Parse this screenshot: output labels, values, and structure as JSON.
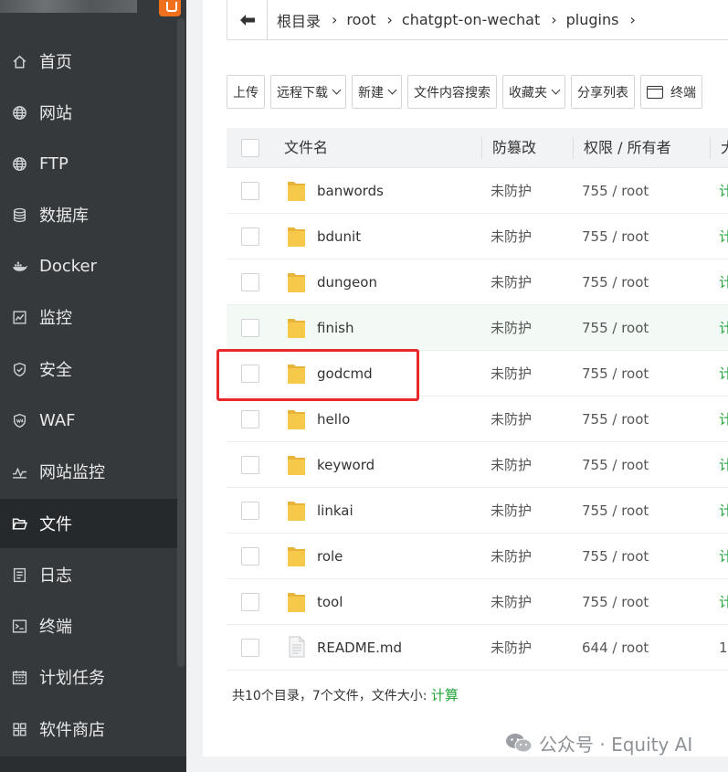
{
  "sidebar": {
    "items": [
      {
        "label": "首页",
        "icon": "home-icon"
      },
      {
        "label": "网站",
        "icon": "globe-icon"
      },
      {
        "label": "FTP",
        "icon": "ftp-globe-icon"
      },
      {
        "label": "数据库",
        "icon": "database-icon"
      },
      {
        "label": "Docker",
        "icon": "docker-whale-icon"
      },
      {
        "label": "监控",
        "icon": "monitor-chart-icon"
      },
      {
        "label": "安全",
        "icon": "shield-icon"
      },
      {
        "label": "WAF",
        "icon": "waf-shield-icon"
      },
      {
        "label": "网站监控",
        "icon": "pulse-line-icon"
      },
      {
        "label": "文件",
        "icon": "folder-open-icon"
      },
      {
        "label": "日志",
        "icon": "log-document-icon"
      },
      {
        "label": "终端",
        "icon": "terminal-icon"
      },
      {
        "label": "计划任务",
        "icon": "calendar-icon"
      },
      {
        "label": "软件商店",
        "icon": "grid-apps-icon"
      }
    ],
    "active_item": "文件"
  },
  "breadcrumb": {
    "items": [
      "根目录",
      "root",
      "chatgpt-on-wechat",
      "plugins"
    ]
  },
  "toolbar": {
    "upload": "上传",
    "remote_download": "远程下载",
    "new": "新建",
    "content_search": "文件内容搜索",
    "favorites": "收藏夹",
    "share_list": "分享列表",
    "terminal": "终端"
  },
  "table": {
    "headers": {
      "name": "文件名",
      "tamper": "防篡改",
      "perm": "权限 / 所有者",
      "size": "大"
    },
    "rows": [
      {
        "name": "banwords",
        "type": "folder",
        "tamper": "未防护",
        "perm": "755 / root",
        "size": "计"
      },
      {
        "name": "bdunit",
        "type": "folder",
        "tamper": "未防护",
        "perm": "755 / root",
        "size": "计"
      },
      {
        "name": "dungeon",
        "type": "folder",
        "tamper": "未防护",
        "perm": "755 / root",
        "size": "计"
      },
      {
        "name": "finish",
        "type": "folder",
        "tamper": "未防护",
        "perm": "755 / root",
        "size": "计"
      },
      {
        "name": "godcmd",
        "type": "folder",
        "tamper": "未防护",
        "perm": "755 / root",
        "size": "计"
      },
      {
        "name": "hello",
        "type": "folder",
        "tamper": "未防护",
        "perm": "755 / root",
        "size": "计"
      },
      {
        "name": "keyword",
        "type": "folder",
        "tamper": "未防护",
        "perm": "755 / root",
        "size": "计"
      },
      {
        "name": "linkai",
        "type": "folder",
        "tamper": "未防护",
        "perm": "755 / root",
        "size": "计"
      },
      {
        "name": "role",
        "type": "folder",
        "tamper": "未防护",
        "perm": "755 / root",
        "size": "计"
      },
      {
        "name": "tool",
        "type": "folder",
        "tamper": "未防护",
        "perm": "755 / root",
        "size": "计"
      },
      {
        "name": "README.md",
        "type": "file",
        "tamper": "未防护",
        "perm": "644 / root",
        "size": "1."
      }
    ],
    "hovered_row": "finish",
    "highlighted_row": "godcmd"
  },
  "summary": {
    "text": "共10个目录，7个文件，文件大小:",
    "calc_link": "计算"
  },
  "watermark": {
    "text": "公众号 · Equity AI"
  },
  "colors": {
    "sidebar_bg": "#35393c",
    "sidebar_active_bg": "#26292b",
    "accent_green": "#20a53a",
    "highlight_red": "#e8282b",
    "folder_yellow": "#f7c94b"
  }
}
